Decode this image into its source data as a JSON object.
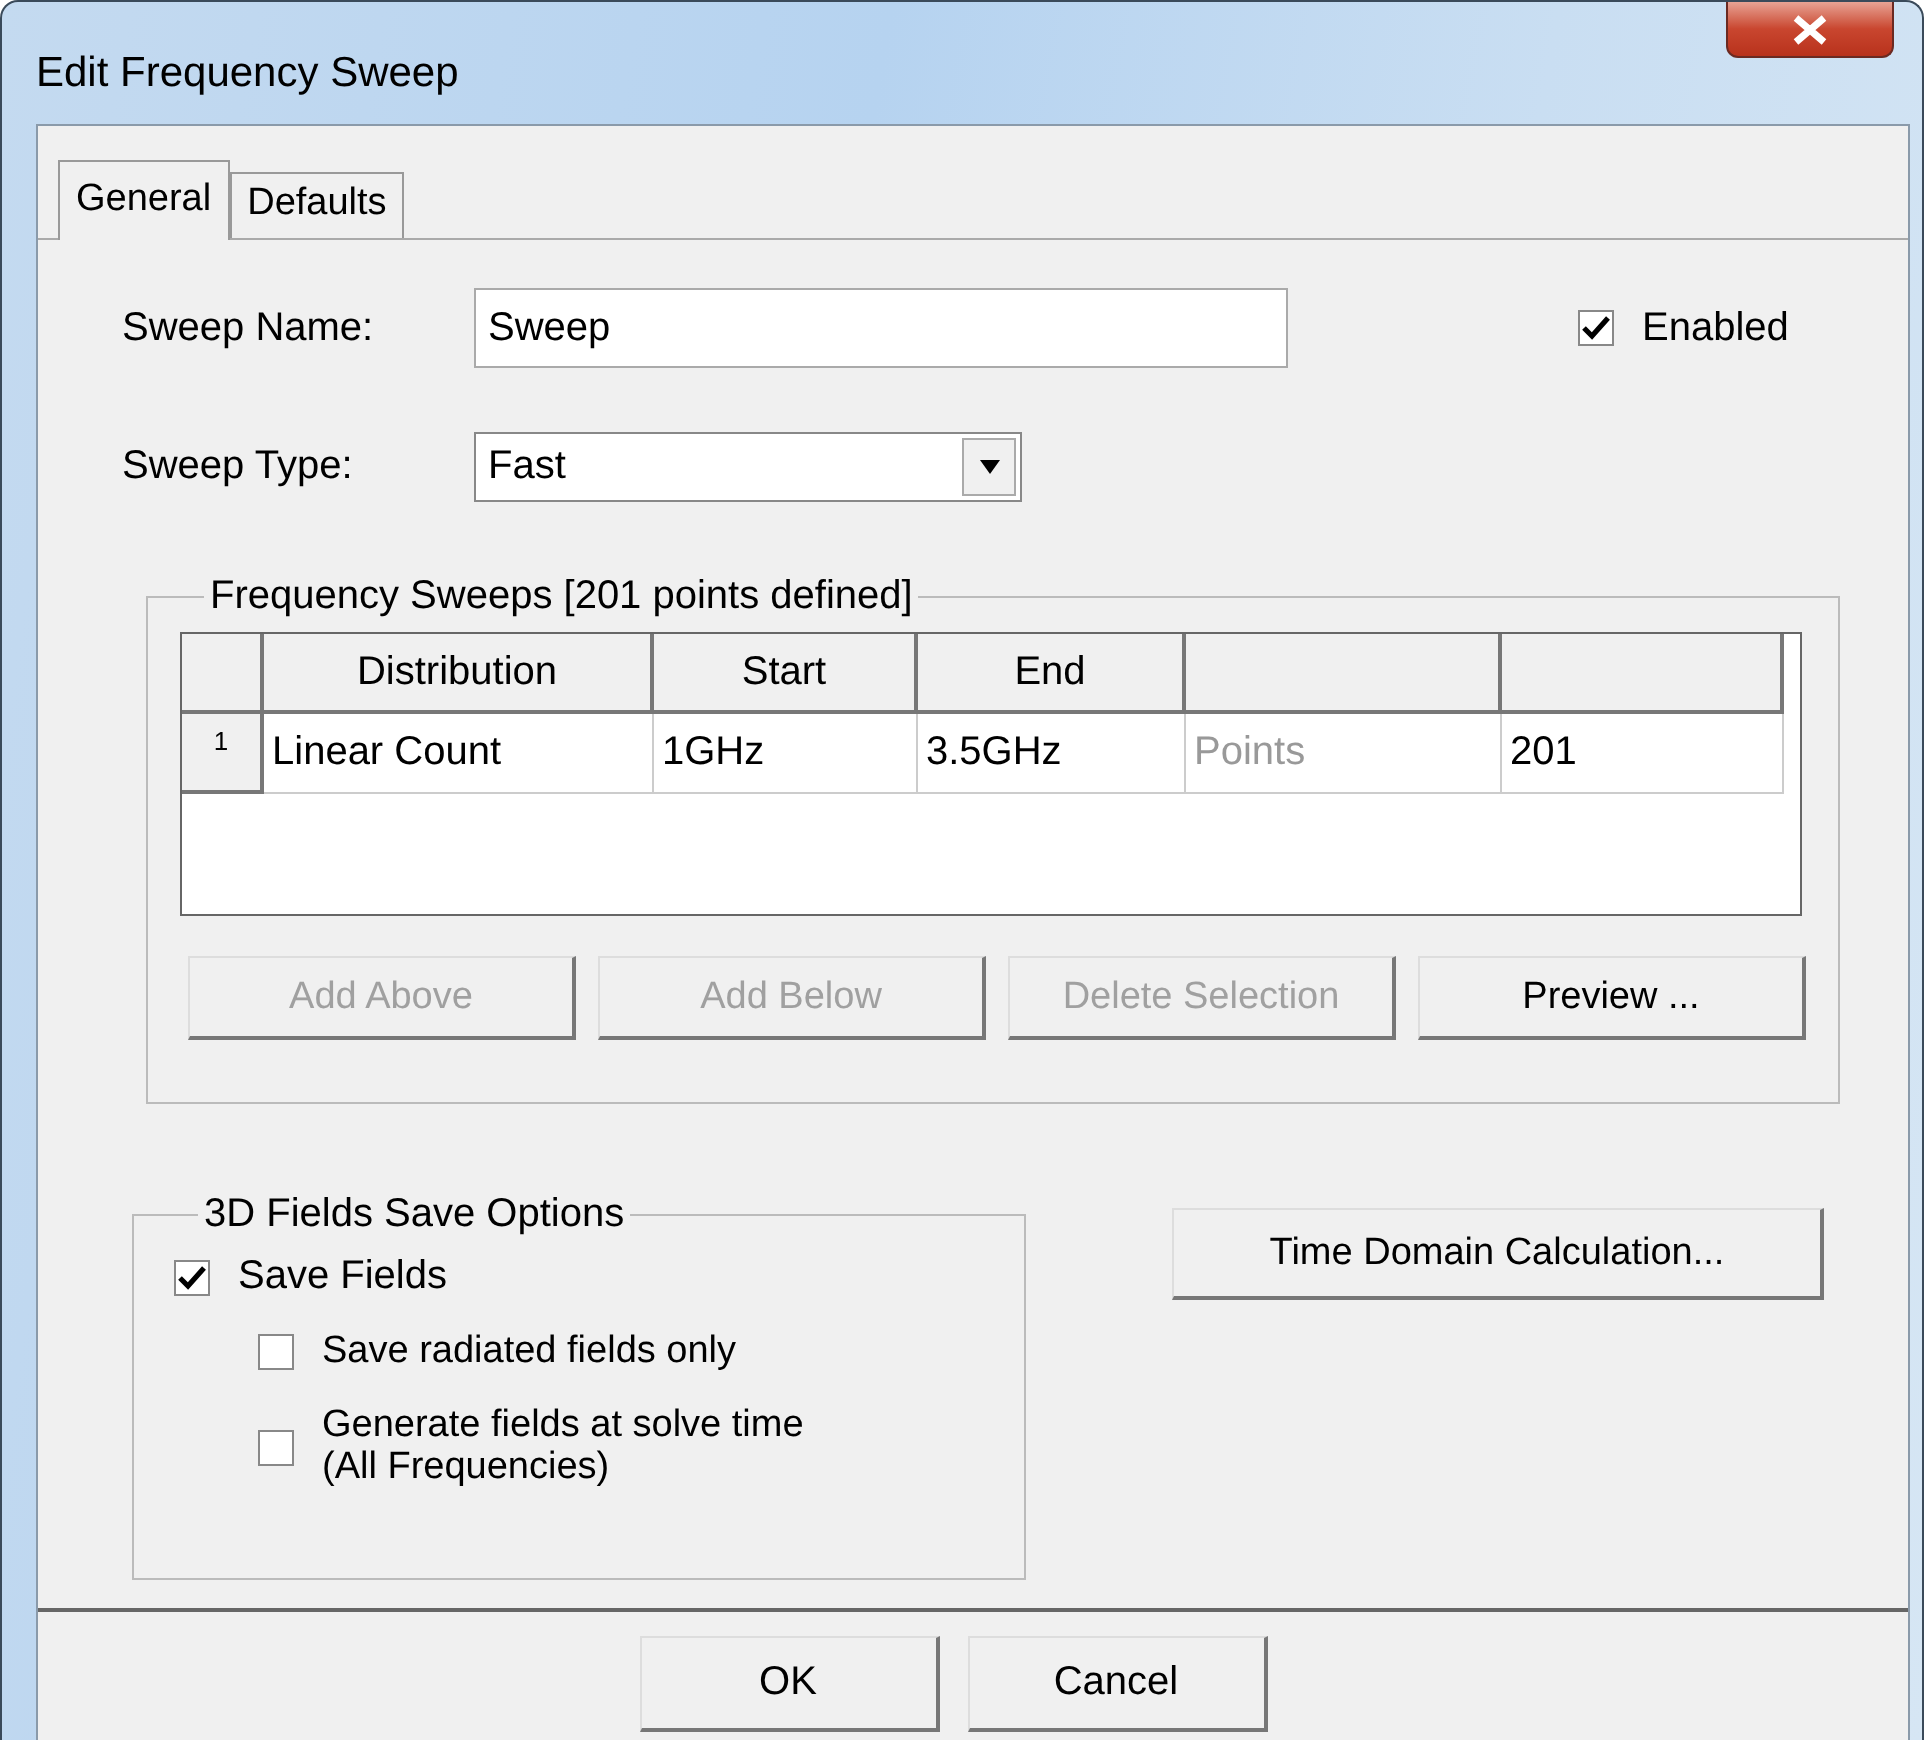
{
  "window": {
    "title": "Edit Frequency Sweep"
  },
  "tabs": [
    {
      "label": "General",
      "selected": true
    },
    {
      "label": "Defaults",
      "selected": false
    }
  ],
  "sweep_name": {
    "label": "Sweep Name:",
    "value": "Sweep"
  },
  "enabled": {
    "label": "Enabled",
    "checked": true
  },
  "sweep_type": {
    "label": "Sweep Type:",
    "value": "Fast"
  },
  "frequency_sweeps": {
    "title": "Frequency Sweeps [201 points defined]",
    "columns": [
      "Distribution",
      "Start",
      "End"
    ],
    "rows": [
      {
        "number": "1",
        "cells": [
          {
            "text": "Linear Count",
            "disabled": false
          },
          {
            "text": "1GHz",
            "disabled": false
          },
          {
            "text": "3.5GHz",
            "disabled": false
          },
          {
            "text": "Points",
            "disabled": true
          },
          {
            "text": "201",
            "disabled": false
          }
        ]
      }
    ],
    "buttons": [
      {
        "label": "Add Above",
        "disabled": true
      },
      {
        "label": "Add Below",
        "disabled": true
      },
      {
        "label": "Delete Selection",
        "disabled": true
      },
      {
        "label": "Preview ...",
        "disabled": false
      }
    ]
  },
  "fields_save_options": {
    "title": "3D Fields Save Options",
    "options": [
      {
        "label": "Save Fields",
        "checked": true,
        "children": [
          {
            "label": "Save radiated fields only",
            "checked": false
          },
          {
            "label": "Generate fields at solve time\n(All Frequencies)",
            "checked": false
          }
        ]
      }
    ]
  },
  "time_domain_button": {
    "label": "Time Domain Calculation..."
  },
  "buttons": [
    {
      "label": "OK"
    },
    {
      "label": "Cancel"
    }
  ]
}
